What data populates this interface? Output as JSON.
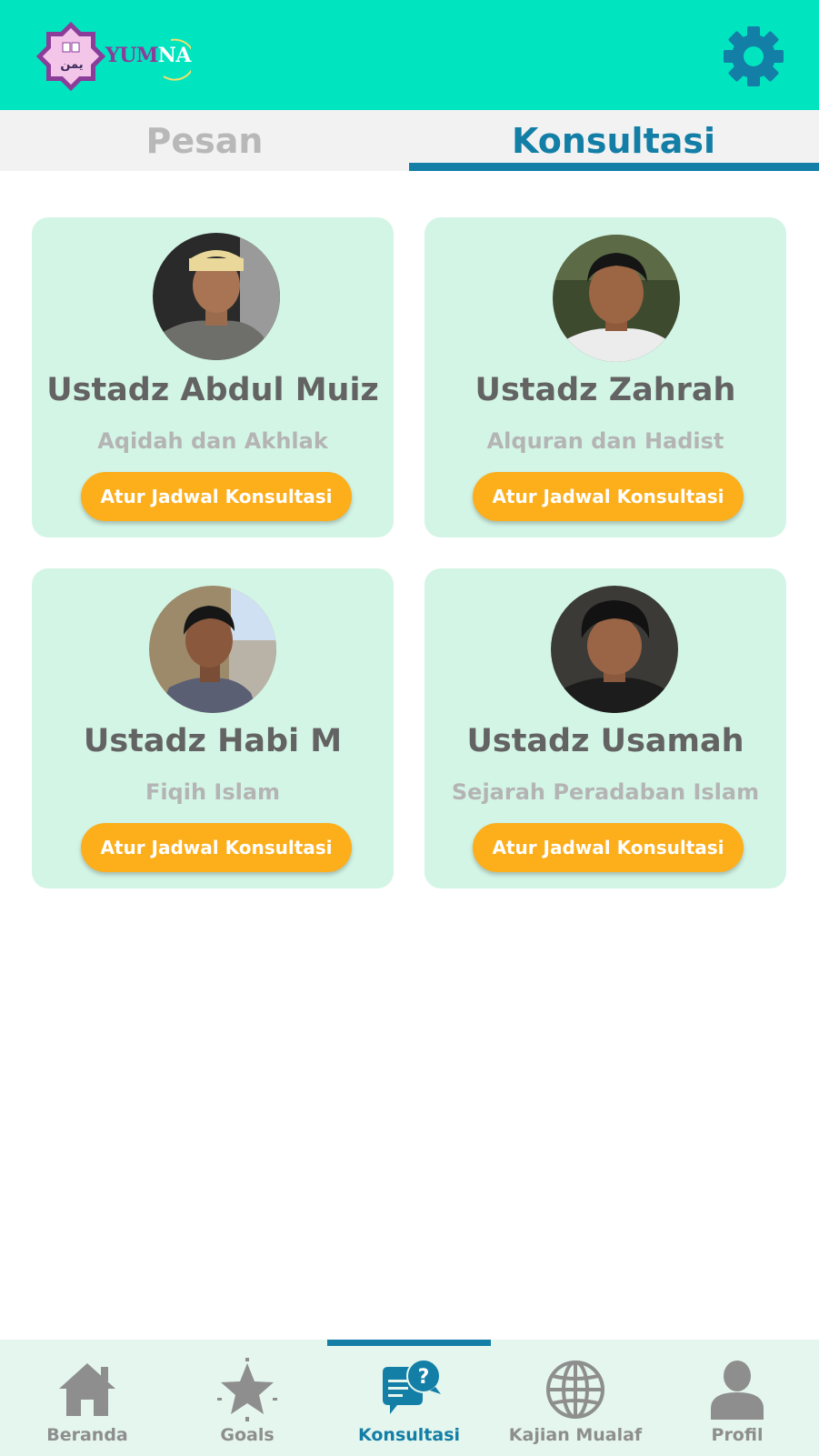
{
  "app": {
    "logo_text_part1": "YUM",
    "logo_text_part2": "NA",
    "logo_arabic": "يمن",
    "colors": {
      "appbar": "#00e4c0",
      "accent": "#137ea6",
      "card": "#d3f5e6",
      "cta": "#fcae1b"
    }
  },
  "tabs": [
    {
      "label": "Pesan",
      "active": false
    },
    {
      "label": "Konsultasi",
      "active": true
    }
  ],
  "consultants": [
    {
      "name": "Ustadz Abdul Muiz",
      "specialty": "Aqidah dan Akhlak",
      "button": "Atur Jadwal Konsultasi"
    },
    {
      "name": "Ustadz Zahrah",
      "specialty": "Alquran dan Hadist",
      "button": "Atur Jadwal Konsultasi"
    },
    {
      "name": "Ustadz Habi M",
      "specialty": "Fiqih Islam",
      "button": "Atur Jadwal Konsultasi"
    },
    {
      "name": "Ustadz Usamah",
      "specialty": "Sejarah Peradaban Islam",
      "button": "Atur Jadwal Konsultasi"
    }
  ],
  "bottom_nav": [
    {
      "label": "Beranda",
      "icon": "home-icon",
      "active": false
    },
    {
      "label": "Goals",
      "icon": "star-icon",
      "active": false
    },
    {
      "label": "Konsultasi",
      "icon": "chat-question-icon",
      "active": true
    },
    {
      "label": "Kajian Mualaf",
      "icon": "globe-icon",
      "active": false
    },
    {
      "label": "Profil",
      "icon": "person-icon",
      "active": false
    }
  ]
}
